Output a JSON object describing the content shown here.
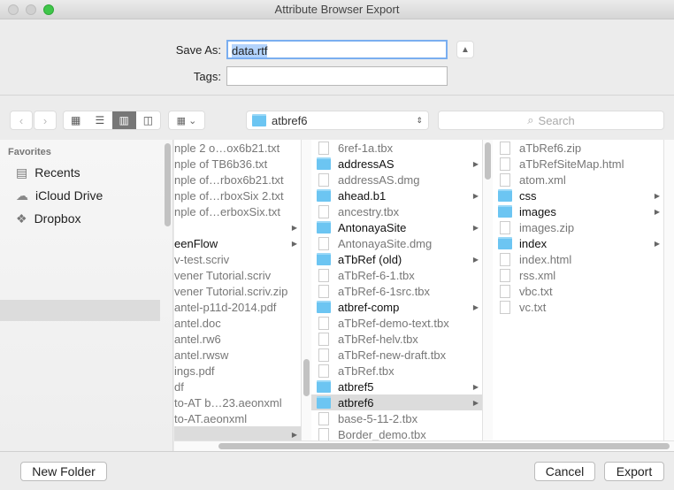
{
  "window": {
    "title": "Attribute Browser Export"
  },
  "form": {
    "save_as_label": "Save As:",
    "save_as_value": "data.rtf",
    "tags_label": "Tags:",
    "tags_value": ""
  },
  "toolbar": {
    "location": "atbref6",
    "search_placeholder": "Search",
    "view_modes": [
      "icon",
      "list",
      "column",
      "cover-flow"
    ],
    "active_view": "column"
  },
  "sidebar": {
    "section": "Favorites",
    "items": [
      {
        "label": "Recents",
        "icon": "recents-icon"
      },
      {
        "label": "iCloud Drive",
        "icon": "cloud-icon"
      },
      {
        "label": "Dropbox",
        "icon": "dropbox-icon"
      }
    ]
  },
  "columns": [
    [
      {
        "name": "nple 2 o…ox6b21.txt"
      },
      {
        "name": "nple of TB6b36.txt"
      },
      {
        "name": "nple of…rbox6b21.txt"
      },
      {
        "name": "nple of…rboxSix 2.txt"
      },
      {
        "name": "nple of…erboxSix.txt"
      },
      {
        "name": "",
        "folder": true
      },
      {
        "name": "eenFlow",
        "folder": true
      },
      {
        "name": "v-test.scriv"
      },
      {
        "name": "vener Tutorial.scriv"
      },
      {
        "name": "vener Tutorial.scriv.zip"
      },
      {
        "name": "antel-p11d-2014.pdf"
      },
      {
        "name": "antel.doc"
      },
      {
        "name": "antel.rw6"
      },
      {
        "name": "antel.rwsw"
      },
      {
        "name": "ings.pdf"
      },
      {
        "name": "df"
      },
      {
        "name": "to-AT b…23.aeonxml"
      },
      {
        "name": "to-AT.aeonxml"
      },
      {
        "name": "",
        "folder": true,
        "selected": true
      }
    ],
    [
      {
        "name": "6ref-1a.tbx"
      },
      {
        "name": "addressAS",
        "folder": true
      },
      {
        "name": "addressAS.dmg"
      },
      {
        "name": "ahead.b1",
        "folder": true
      },
      {
        "name": "ancestry.tbx"
      },
      {
        "name": "AntonayaSite",
        "folder": true
      },
      {
        "name": "AntonayaSite.dmg"
      },
      {
        "name": "aTbRef (old)",
        "folder": true
      },
      {
        "name": "aTbRef-6-1.tbx"
      },
      {
        "name": "aTbRef-6-1src.tbx"
      },
      {
        "name": "atbref-comp",
        "folder": true
      },
      {
        "name": "aTbRef-demo-text.tbx"
      },
      {
        "name": "aTbRef-helv.tbx"
      },
      {
        "name": "aTbRef-new-draft.tbx"
      },
      {
        "name": "aTbRef.tbx"
      },
      {
        "name": "atbref5",
        "folder": true
      },
      {
        "name": "atbref6",
        "folder": true,
        "selected": true
      },
      {
        "name": "base-5-11-2.tbx"
      },
      {
        "name": "Border_demo.tbx"
      }
    ],
    [
      {
        "name": "aTbRef6.zip"
      },
      {
        "name": "aTbRefSiteMap.html"
      },
      {
        "name": "atom.xml"
      },
      {
        "name": "css",
        "folder": true
      },
      {
        "name": "images",
        "folder": true
      },
      {
        "name": "images.zip"
      },
      {
        "name": "index",
        "folder": true
      },
      {
        "name": "index.html"
      },
      {
        "name": "rss.xml"
      },
      {
        "name": "vbc.txt"
      },
      {
        "name": "vc.txt"
      }
    ]
  ],
  "footer": {
    "new_folder": "New Folder",
    "cancel": "Cancel",
    "export": "Export"
  }
}
